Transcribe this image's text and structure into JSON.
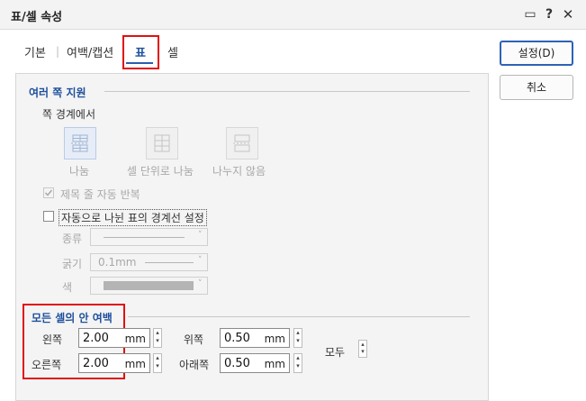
{
  "window": {
    "title": "표/셀 속성"
  },
  "tabs": [
    {
      "label": "기본"
    },
    {
      "label": "여백/캡션"
    },
    {
      "label": "표"
    },
    {
      "label": "셀"
    }
  ],
  "buttons": {
    "ok": "설정(D)",
    "cancel": "취소"
  },
  "section_split": {
    "title": "여러 쪽 지원",
    "subtitle": "쪽 경계에서",
    "options": [
      {
        "label": "나눔",
        "icon": "split-table-icon"
      },
      {
        "label": "셀 단위로 나눔",
        "icon": "split-by-cell-icon"
      },
      {
        "label": "나누지 않음",
        "icon": "no-split-icon"
      }
    ],
    "repeat_header": "제목 줄 자동 반복",
    "auto_border": "자동으로 나뉜 표의 경계선 설정",
    "line_type_label": "종류",
    "thickness_label": "굵기",
    "thickness_value": "0.1mm",
    "color_label": "색"
  },
  "section_margin": {
    "title": "모든 셀의 안 여백",
    "left_label": "왼쪽",
    "left_value": "2.00",
    "right_label": "오른쪽",
    "right_value": "2.00",
    "top_label": "위쪽",
    "top_value": "0.50",
    "bottom_label": "아래쪽",
    "bottom_value": "0.50",
    "unit": "mm",
    "all_label": "모두"
  },
  "colors": {
    "accent": "#1d4f9c",
    "highlight": "#e01010"
  }
}
